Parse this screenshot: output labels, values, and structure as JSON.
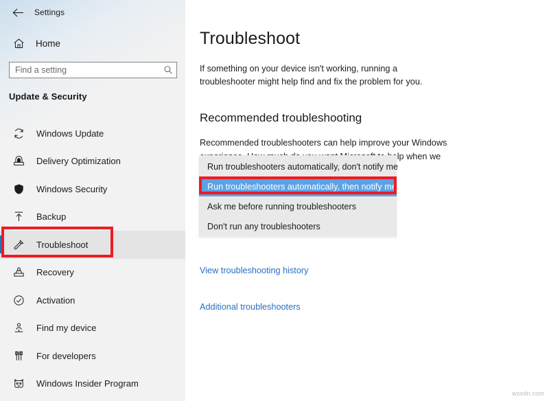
{
  "app": {
    "title": "Settings",
    "back_icon": "back-arrow-icon"
  },
  "sidebar": {
    "home": {
      "label": "Home",
      "icon": "home-icon"
    },
    "search": {
      "placeholder": "Find a setting",
      "value": "",
      "icon": "search-icon"
    },
    "group_header": "Update & Security",
    "items": [
      {
        "label": "Windows Update",
        "icon": "sync-icon",
        "selected": false
      },
      {
        "label": "Delivery Optimization",
        "icon": "delivery-box-icon",
        "selected": false
      },
      {
        "label": "Windows Security",
        "icon": "shield-icon",
        "selected": false
      },
      {
        "label": "Backup",
        "icon": "upload-arrow-icon",
        "selected": false
      },
      {
        "label": "Troubleshoot",
        "icon": "wrench-icon",
        "selected": true
      },
      {
        "label": "Recovery",
        "icon": "recovery-icon",
        "selected": false
      },
      {
        "label": "Activation",
        "icon": "check-circle-icon",
        "selected": false
      },
      {
        "label": "Find my device",
        "icon": "person-location-icon",
        "selected": false
      },
      {
        "label": "For developers",
        "icon": "developer-tools-icon",
        "selected": false
      },
      {
        "label": "Windows Insider Program",
        "icon": "insider-icon",
        "selected": false
      }
    ]
  },
  "main": {
    "page_title": "Troubleshoot",
    "intro": "If something on your device isn't working, running a troubleshooter might help find and fix the problem for you.",
    "section_title": "Recommended troubleshooting",
    "section_body": "Recommended troubleshooters can help improve your Windows experience. How much do you want Microsoft to help when we find problems you may be able to fix?",
    "dropdown": {
      "options": [
        "Run troubleshooters automatically, don't notify me",
        "Run troubleshooters automatically, then notify me",
        "Ask me before running troubleshooters",
        "Don't run any troubleshooters"
      ],
      "highlighted_index": 1
    },
    "links": [
      "View troubleshooting history",
      "Additional troubleshooters"
    ]
  },
  "annotations": {
    "color": "#ee1b24",
    "boxes": [
      "sidebar-troubleshoot-item",
      "dropdown-option-run-then-notify"
    ]
  },
  "colors": {
    "accent_blue": "#2f6fb5",
    "highlight_blue": "#5ca2e4",
    "link_blue": "#2a6fc0",
    "sidebar_bg": "#f2f2f2",
    "flyout_bg": "#e9e9e9",
    "progress_fill": "#2a7cb8"
  },
  "scrollbar": {
    "progress_label": ""
  },
  "watermark": "wsxdn.com"
}
